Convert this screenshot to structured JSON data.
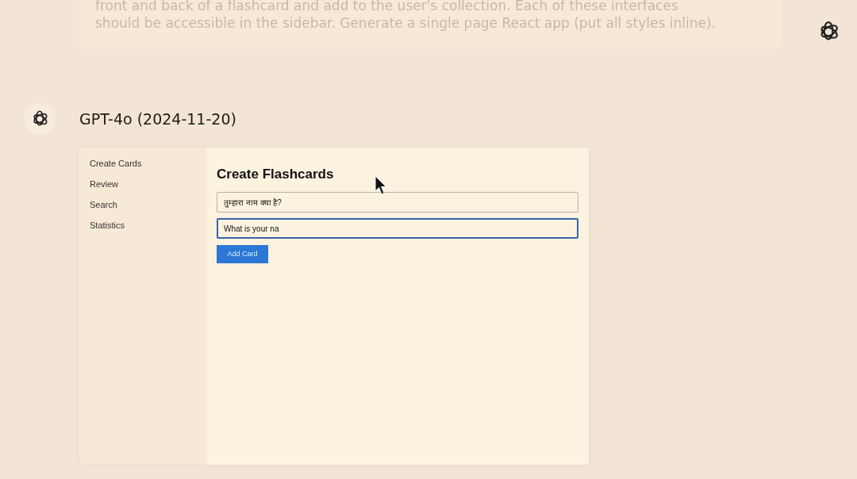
{
  "prompt": {
    "lines": [
      "front and back of a flashcard and add to the user's collection. Each of these interfaces",
      "should be accessible in the sidebar. Generate a single page React app (put all styles inline)."
    ]
  },
  "response": {
    "model": "GPT-4o (2024-11-20)",
    "app": {
      "sidebar": [
        {
          "label": "Create Cards"
        },
        {
          "label": "Review"
        },
        {
          "label": "Search"
        },
        {
          "label": "Statistics"
        }
      ],
      "heading": "Create Flashcards",
      "fields": [
        {
          "value": "तुम्हारा नाम क्या है?",
          "focused": false
        },
        {
          "value": "What is your na",
          "focused": true
        }
      ],
      "button": "Add Card"
    }
  }
}
